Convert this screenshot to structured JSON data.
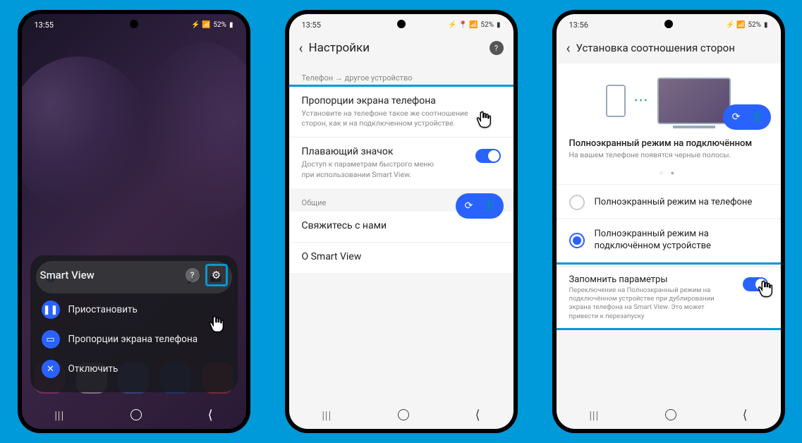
{
  "status": {
    "time1": "13:55",
    "time2": "13:55",
    "time3": "13:56",
    "battery": "52%",
    "icons_left": "⏱ ⊙ ⊙",
    "icons_right": "📶 ⚡"
  },
  "phone1": {
    "smartview": {
      "title": "Smart View",
      "pause": "Приостановить",
      "ratio": "Пропорции экрана телефона",
      "disconnect": "Отключить"
    }
  },
  "phone2": {
    "header": "Настройки",
    "section1": "Телефон → другое устройство",
    "item1_title": "Пропорции экрана телефона",
    "item1_sub": "Установите на телефоне такое же соотношение сторон, как и на подключенном устройстве.",
    "item2_title": "Плавающий значок",
    "item2_sub": "Доступ к параметрам быстрого меню при использовании Smart View.",
    "section2": "Общие",
    "item3": "Свяжитесь с нами",
    "item4": "О Smart View"
  },
  "phone3": {
    "header": "Установка соотношения сторон",
    "mode_title": "Полноэкранный режим на подключённом",
    "mode_sub": "На вашем телефоне появятся черные полосы.",
    "radio1": "Полноэкранный режим на телефоне",
    "radio2": "Полноэкранный режим на подключённом устройстве",
    "remember_title": "Запомнить параметры",
    "remember_sub": "Переключение на Полноэкранный режим на подключённом устройстве при дублировании экрана телефона на Smart View. Это может привести к перезапуску"
  }
}
